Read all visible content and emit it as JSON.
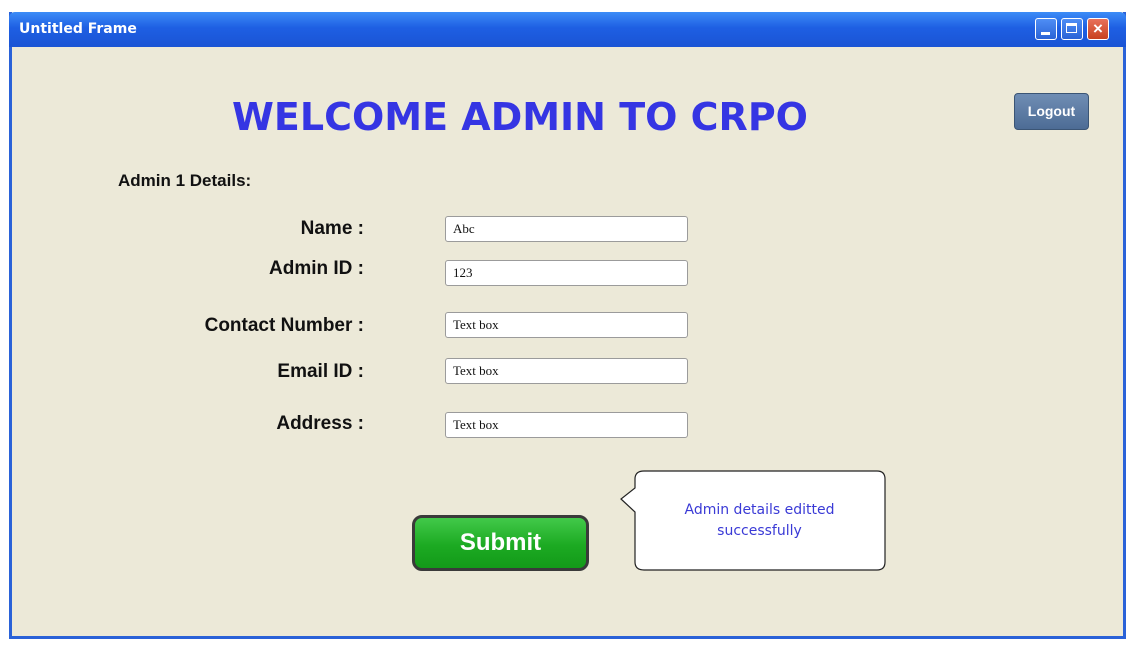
{
  "window": {
    "title": "Untitled Frame",
    "buttons": {
      "minimize": "minimize",
      "maximize": "maximize",
      "close": "×"
    }
  },
  "header": {
    "title": "WELCOME ADMIN TO CRPO",
    "logout_label": "Logout"
  },
  "form": {
    "section_label": "Admin 1 Details:",
    "fields": [
      {
        "label": "Name :",
        "value": "Abc"
      },
      {
        "label": "Admin ID :",
        "value": "123"
      },
      {
        "label": "Contact Number :",
        "value": "Text box"
      },
      {
        "label": "Email ID :",
        "value": "Text box"
      },
      {
        "label": "Address :",
        "value": "Text box"
      }
    ],
    "submit_label": "Submit"
  },
  "notification": {
    "message_line1": "Admin details editted",
    "message_line2": "successfully"
  },
  "colors": {
    "heading": "#3535e3",
    "titlebar": "#1e5fe3",
    "submit": "#1caa22",
    "background": "#ece9d8"
  }
}
